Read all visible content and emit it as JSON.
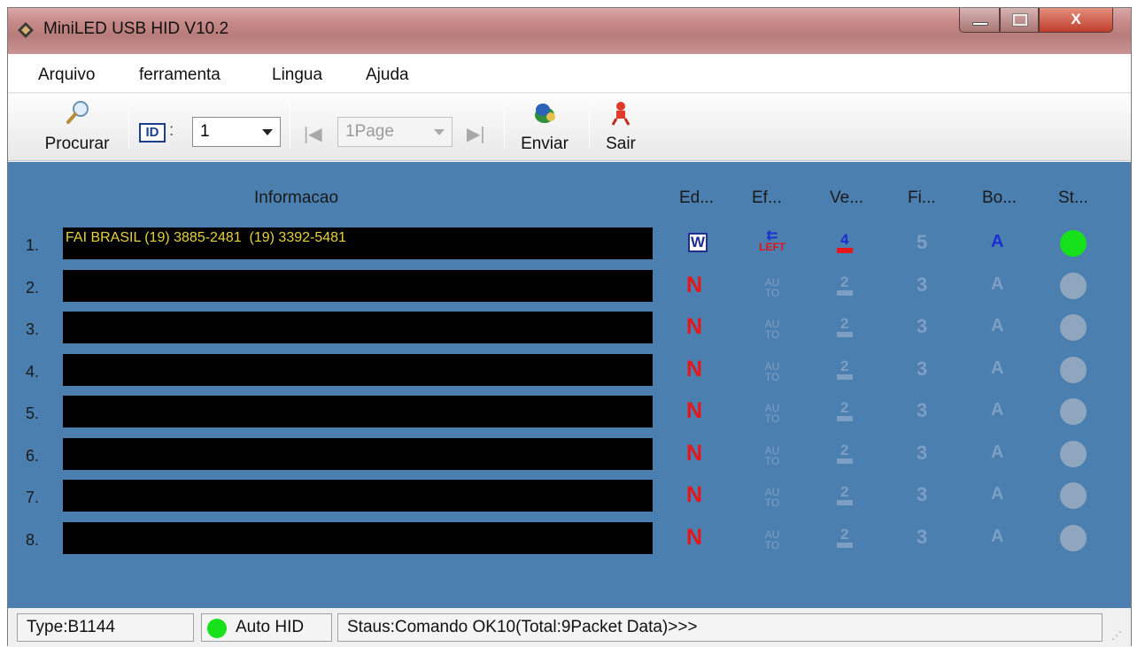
{
  "window": {
    "title": "MiniLED USB HID V10.2",
    "close_label": "X"
  },
  "menu": [
    "Arquivo",
    "ferramenta",
    "Lingua",
    "Ajuda"
  ],
  "toolbar": {
    "search_label": "Procurar",
    "id_label": "ID",
    "id_colon": ":",
    "id_value": "1",
    "page_value": "1Page",
    "send_label": "Enviar",
    "exit_label": "Sair"
  },
  "table": {
    "headers": {
      "info": "Informacao",
      "ed": "Ed...",
      "ef": "Ef...",
      "ve": "Ve...",
      "fi": "Fi...",
      "bo": "Bo...",
      "st": "St..."
    },
    "rows": [
      {
        "num": "1.",
        "text": "FAI BRASIL (19) 3885-2481  (19) 3392-5481",
        "ed": "W",
        "ef": "LEFT",
        "ve": "4",
        "fi": "5",
        "bo": "A",
        "active": true
      },
      {
        "num": "2.",
        "text": "",
        "ed": "N",
        "ef": "AUTO",
        "ve": "2",
        "fi": "3",
        "bo": "A",
        "active": false
      },
      {
        "num": "3.",
        "text": "",
        "ed": "N",
        "ef": "AUTO",
        "ve": "2",
        "fi": "3",
        "bo": "A",
        "active": false
      },
      {
        "num": "4.",
        "text": "",
        "ed": "N",
        "ef": "AUTO",
        "ve": "2",
        "fi": "3",
        "bo": "A",
        "active": false
      },
      {
        "num": "5.",
        "text": "",
        "ed": "N",
        "ef": "AUTO",
        "ve": "2",
        "fi": "3",
        "bo": "A",
        "active": false
      },
      {
        "num": "6.",
        "text": "",
        "ed": "N",
        "ef": "AUTO",
        "ve": "2",
        "fi": "3",
        "bo": "A",
        "active": false
      },
      {
        "num": "7.",
        "text": "",
        "ed": "N",
        "ef": "AUTO",
        "ve": "2",
        "fi": "3",
        "bo": "A",
        "active": false
      },
      {
        "num": "8.",
        "text": "",
        "ed": "N",
        "ef": "AUTO",
        "ve": "2",
        "fi": "3",
        "bo": "A",
        "active": false
      }
    ]
  },
  "statusbar": {
    "type": "Type:B1144",
    "mode": "Auto HID",
    "status": "Staus:Comando OK10(Total:9Packet Data)>>>"
  },
  "colors": {
    "panel": "#4a7fb0",
    "led_text": "#e6d23a",
    "active_dot": "#16e11a",
    "inactive_dot": "#8fa6bf",
    "red": "#e8151a",
    "blue": "#1d2fd0"
  }
}
